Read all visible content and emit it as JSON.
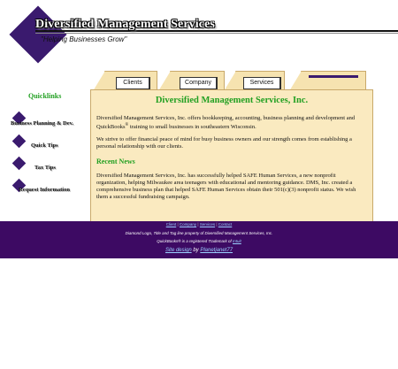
{
  "header": {
    "title": "Diversified Management Services",
    "tagline": "\"Helping Businesses Grow\""
  },
  "tabs": [
    {
      "label": "Clients"
    },
    {
      "label": "Company"
    },
    {
      "label": "Services"
    },
    {
      "label": ""
    }
  ],
  "quicklinks": {
    "title": "Quicklinks",
    "items": [
      {
        "label": "Business Planning & Dev."
      },
      {
        "label": "Quick Tips"
      },
      {
        "label": "Tax Tips"
      },
      {
        "label": "Request Information"
      }
    ]
  },
  "main": {
    "heading": "Diversified Management Services, Inc.",
    "intro_before": "Diversified Management Services, Inc. offers bookkeeping, accounting, business planning and development and QuickBooks",
    "intro_reg": "®",
    "intro_after": " training to small businesses in southeastern Wisconsin.",
    "mission": "We strive to offer financial peace of mind for busy business owners and our strength comes from establishing a personal relationship with our clients.",
    "news_heading": "Recent News",
    "news_text": "Diversified Management Services, Inc. has successfully helped SAFE Human Services, a new nonprofit organization, helping Milwaukee area teenagers with educational and mentoring guidance. DMS, Inc. created a comprehensive business plan that helped SAFE Human Services obtain their 501(c)(3) nonprofit status. We wish them a successful fundraising campaign."
  },
  "footer": {
    "links": [
      "Client",
      "Company",
      "Services",
      "Contact"
    ],
    "separator": " | ",
    "copyright": "Diamond Logo, Title and Tag line property of Diversified Management Services, Inc.",
    "qb_text": "QuickBooks® is a registered Trademark of ",
    "qb_link": "Intuit",
    "design_prefix": "Site design",
    "design_by": " by ",
    "designer": "Planetjanet77"
  },
  "colors": {
    "brand_purple": "#3a1a6e",
    "footer_purple": "#3d0a63",
    "heading_green": "#22a022",
    "panel_bg": "#faeac0"
  }
}
